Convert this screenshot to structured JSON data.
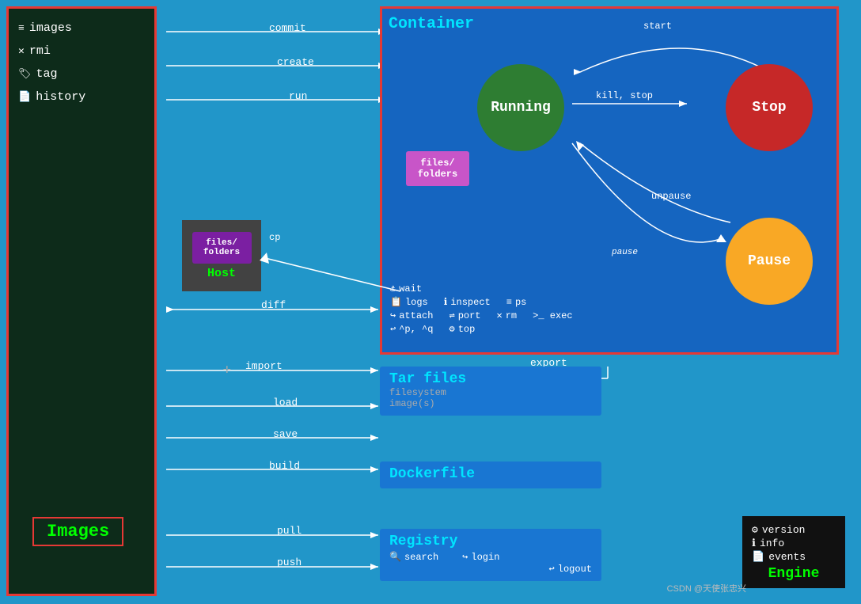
{
  "sidebar": {
    "items": [
      {
        "label": "images",
        "icon": "≡"
      },
      {
        "label": "rmi",
        "icon": "✕"
      },
      {
        "label": "tag",
        "icon": "🏷"
      },
      {
        "label": "history",
        "icon": "📄"
      }
    ],
    "images_label": "Images"
  },
  "commands": {
    "commit": "commit",
    "create": "create",
    "run": "run",
    "diff": "diff",
    "import": "import",
    "load": "load",
    "save": "save",
    "build": "build",
    "pull": "pull",
    "push": "push",
    "cp": "cp",
    "export": "export"
  },
  "container": {
    "title": "Container",
    "states": {
      "running": "Running",
      "stop": "Stop",
      "pause": "Pause"
    },
    "transitions": {
      "start": "start",
      "kill_stop": "kill, stop",
      "unpause": "unpause",
      "pause": "pause"
    },
    "files_folders": "files/\nfolders",
    "commands": {
      "wait": "wait",
      "logs": "logs",
      "attach": "attach",
      "ctrl_pq": "^p, ^q",
      "inspect": "inspect",
      "port": "port",
      "top": "top",
      "ps": "ps",
      "rm": "rm",
      "exec": ">_ exec"
    }
  },
  "tar_files": {
    "title": "Tar files",
    "filesystem": "filesystem",
    "images": "image(s)"
  },
  "dockerfile": {
    "title": "Dockerfile"
  },
  "registry": {
    "title": "Registry",
    "commands": {
      "search": "search",
      "login": "login",
      "logout": "logout"
    }
  },
  "engine": {
    "title": "Engine",
    "items": [
      {
        "icon": "⚙",
        "label": "version"
      },
      {
        "icon": "ℹ",
        "label": "info"
      },
      {
        "icon": "📄",
        "label": "events"
      }
    ]
  },
  "host": {
    "label": "Host"
  },
  "watermark": "CSDN @天使张忠兴"
}
